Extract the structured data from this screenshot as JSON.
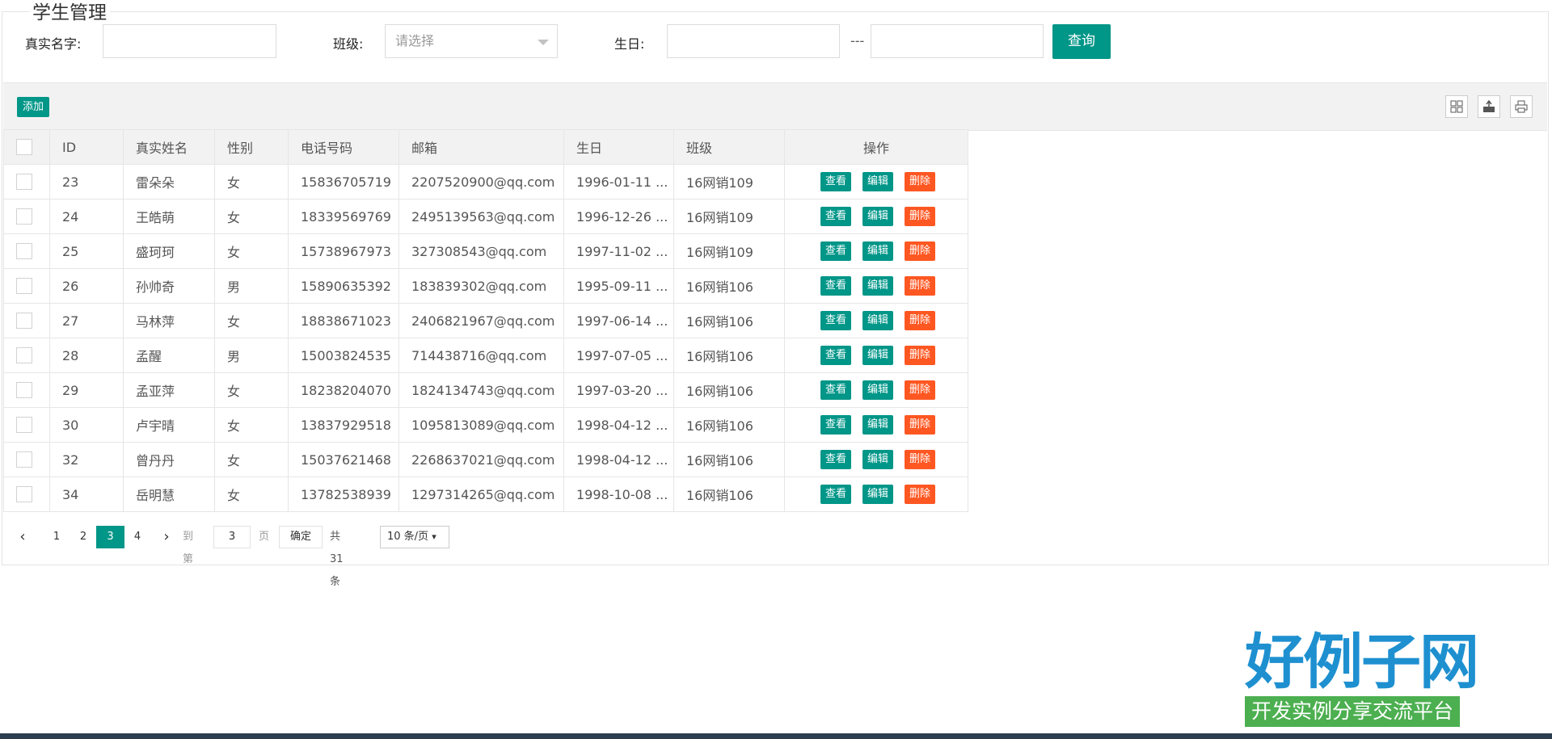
{
  "page": {
    "title": "学生管理"
  },
  "filters": {
    "real_name_label": "真实名字:",
    "real_name_value": "",
    "class_label": "班级:",
    "class_placeholder": "请选择",
    "birthday_label": "生日:",
    "birthday_separator": "---",
    "birthday_from": "",
    "birthday_to": "",
    "query_label": "查询"
  },
  "toolbar": {
    "add_label": "添加",
    "icons": [
      "columns-icon",
      "export-icon",
      "print-icon"
    ]
  },
  "table": {
    "headers": [
      "ID",
      "真实姓名",
      "性别",
      "电话号码",
      "邮箱",
      "生日",
      "班级",
      "操作"
    ],
    "action_labels": {
      "view": "查看",
      "edit": "编辑",
      "delete": "删除"
    },
    "rows": [
      {
        "id": "23",
        "name": "雷朵朵",
        "gender": "女",
        "phone": "15836705719",
        "email": "2207520900@qq.com",
        "birthday": "1996-01-11 ...",
        "class": "16网销109"
      },
      {
        "id": "24",
        "name": "王皓萌",
        "gender": "女",
        "phone": "18339569769",
        "email": "2495139563@qq.com",
        "birthday": "1996-12-26 ...",
        "class": "16网销109"
      },
      {
        "id": "25",
        "name": "盛珂珂",
        "gender": "女",
        "phone": "15738967973",
        "email": "327308543@qq.com",
        "birthday": "1997-11-02 ...",
        "class": "16网销109"
      },
      {
        "id": "26",
        "name": "孙帅奇",
        "gender": "男",
        "phone": "15890635392",
        "email": "183839302@qq.com",
        "birthday": "1995-09-11 ...",
        "class": "16网销106"
      },
      {
        "id": "27",
        "name": "马林萍",
        "gender": "女",
        "phone": "18838671023",
        "email": "2406821967@qq.com",
        "birthday": "1997-06-14 ...",
        "class": "16网销106"
      },
      {
        "id": "28",
        "name": "孟醒",
        "gender": "男",
        "phone": "15003824535",
        "email": "714438716@qq.com",
        "birthday": "1997-07-05 ...",
        "class": "16网销106"
      },
      {
        "id": "29",
        "name": "孟亚萍",
        "gender": "女",
        "phone": "18238204070",
        "email": "1824134743@qq.com",
        "birthday": "1997-03-20 ...",
        "class": "16网销106"
      },
      {
        "id": "30",
        "name": "卢宇晴",
        "gender": "女",
        "phone": "13837929518",
        "email": "1095813089@qq.com",
        "birthday": "1998-04-12 ...",
        "class": "16网销106"
      },
      {
        "id": "32",
        "name": "曾丹丹",
        "gender": "女",
        "phone": "15037621468",
        "email": "2268637021@qq.com",
        "birthday": "1998-04-12 ...",
        "class": "16网销106"
      },
      {
        "id": "34",
        "name": "岳明慧",
        "gender": "女",
        "phone": "13782538939",
        "email": "1297314265@qq.com",
        "birthday": "1998-10-08 ...",
        "class": "16网销106"
      }
    ]
  },
  "pager": {
    "pages": [
      "1",
      "2",
      "3",
      "4"
    ],
    "current": "3",
    "goto_prefix": "到第",
    "goto_value": "3",
    "goto_suffix": "页",
    "confirm_label": "确定",
    "total_label": "共 31 条",
    "page_size": "10 条/页"
  },
  "watermark": {
    "logo_main": "好例子网",
    "logo_sub": "开发实例分享交流平台"
  },
  "colors": {
    "primary": "#009688",
    "danger": "#ff5722",
    "header_bg": "#f2f2f2",
    "border": "#e6e6e6"
  }
}
